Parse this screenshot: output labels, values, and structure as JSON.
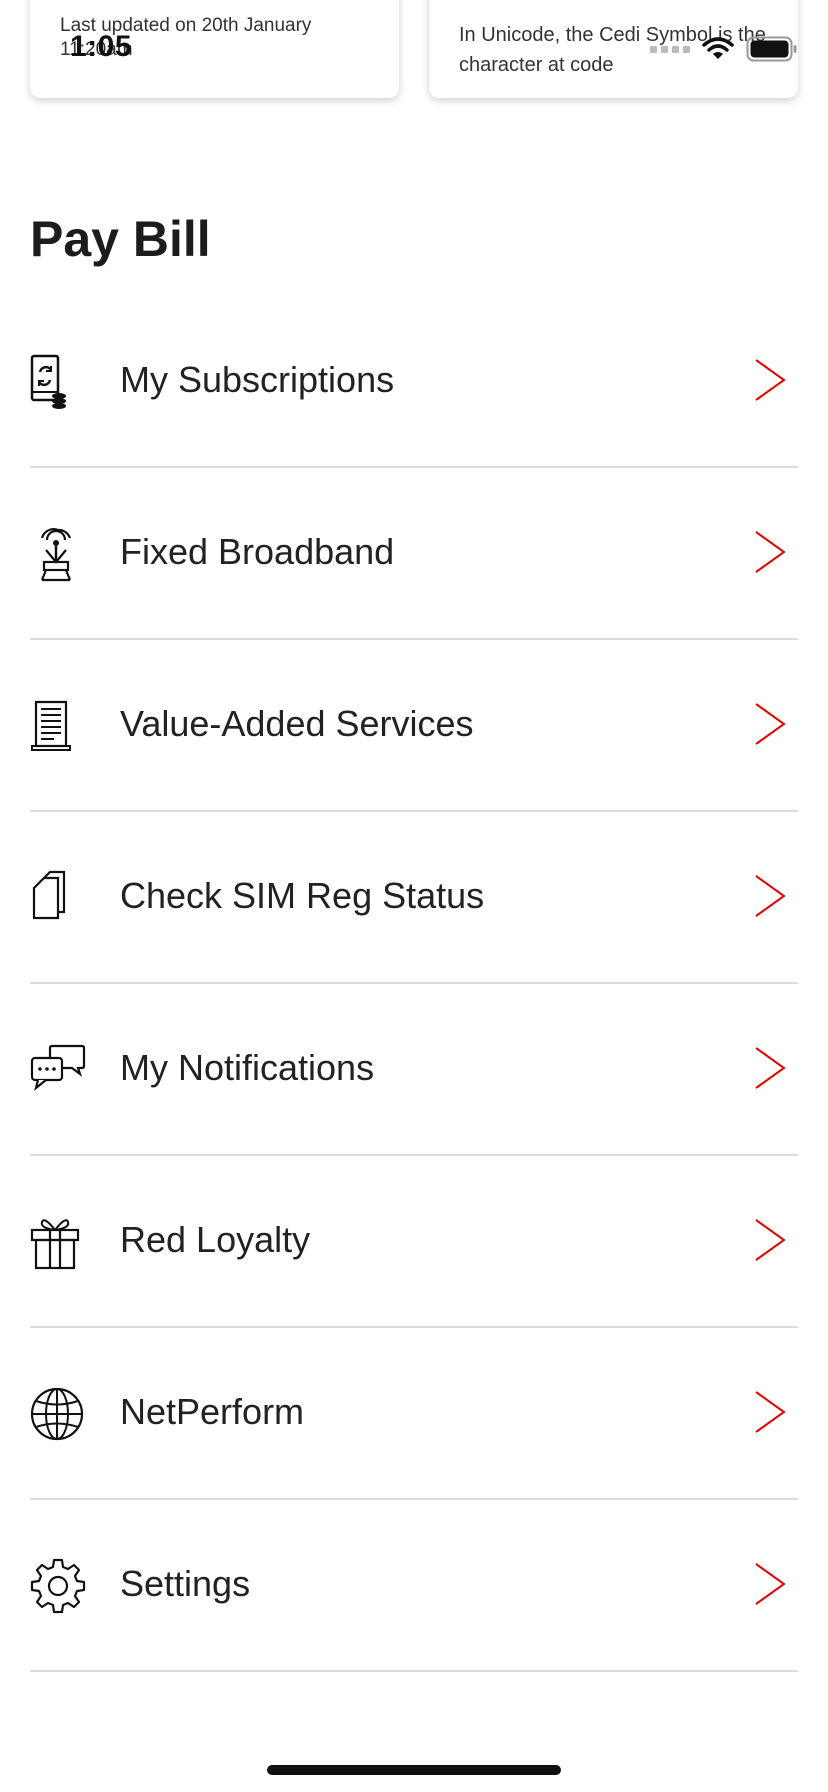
{
  "status_bar": {
    "time": "1:05"
  },
  "cards": {
    "left_text": "Last updated on 20th January 11:20am",
    "right_text": "In Unicode, the Cedi Symbol is the character at code"
  },
  "section_title": "Pay Bill",
  "menu": {
    "items": [
      {
        "label": "My Subscriptions",
        "icon": "phone-subscriptions-icon"
      },
      {
        "label": "Fixed Broadband",
        "icon": "broadband-antenna-icon"
      },
      {
        "label": "Value-Added Services",
        "icon": "document-icon"
      },
      {
        "label": "Check SIM Reg Status",
        "icon": "sim-card-icon"
      },
      {
        "label": "My Notifications",
        "icon": "chat-bubbles-icon"
      },
      {
        "label": "Red Loyalty",
        "icon": "gift-icon"
      },
      {
        "label": "NetPerform",
        "icon": "globe-icon"
      },
      {
        "label": "Settings",
        "icon": "gear-icon"
      }
    ]
  },
  "colors": {
    "accent": "#e60000",
    "divider": "#dcdcdc",
    "text": "#1c1c1c"
  }
}
